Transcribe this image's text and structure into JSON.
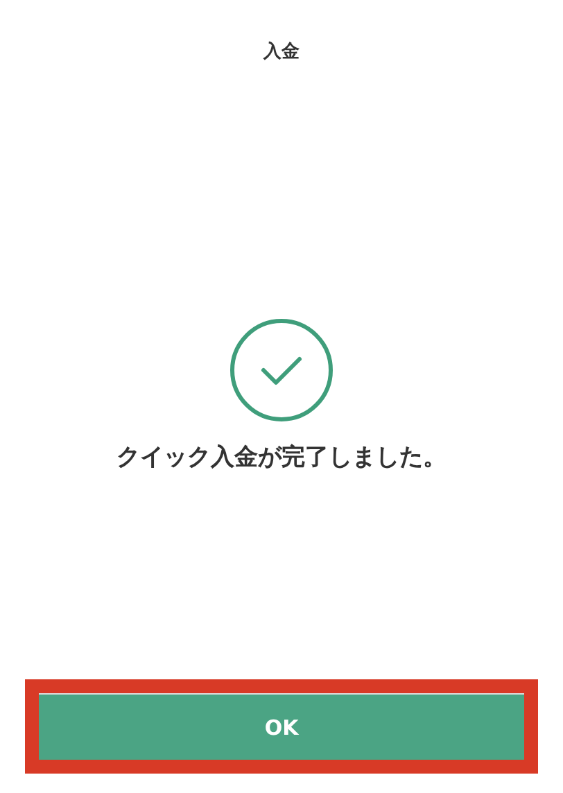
{
  "header": {
    "title": "入金"
  },
  "result": {
    "kind": "success",
    "message": "クイック入金が完了しました。"
  },
  "footer": {
    "button": {
      "label": "OK",
      "highlighted": true
    }
  }
}
